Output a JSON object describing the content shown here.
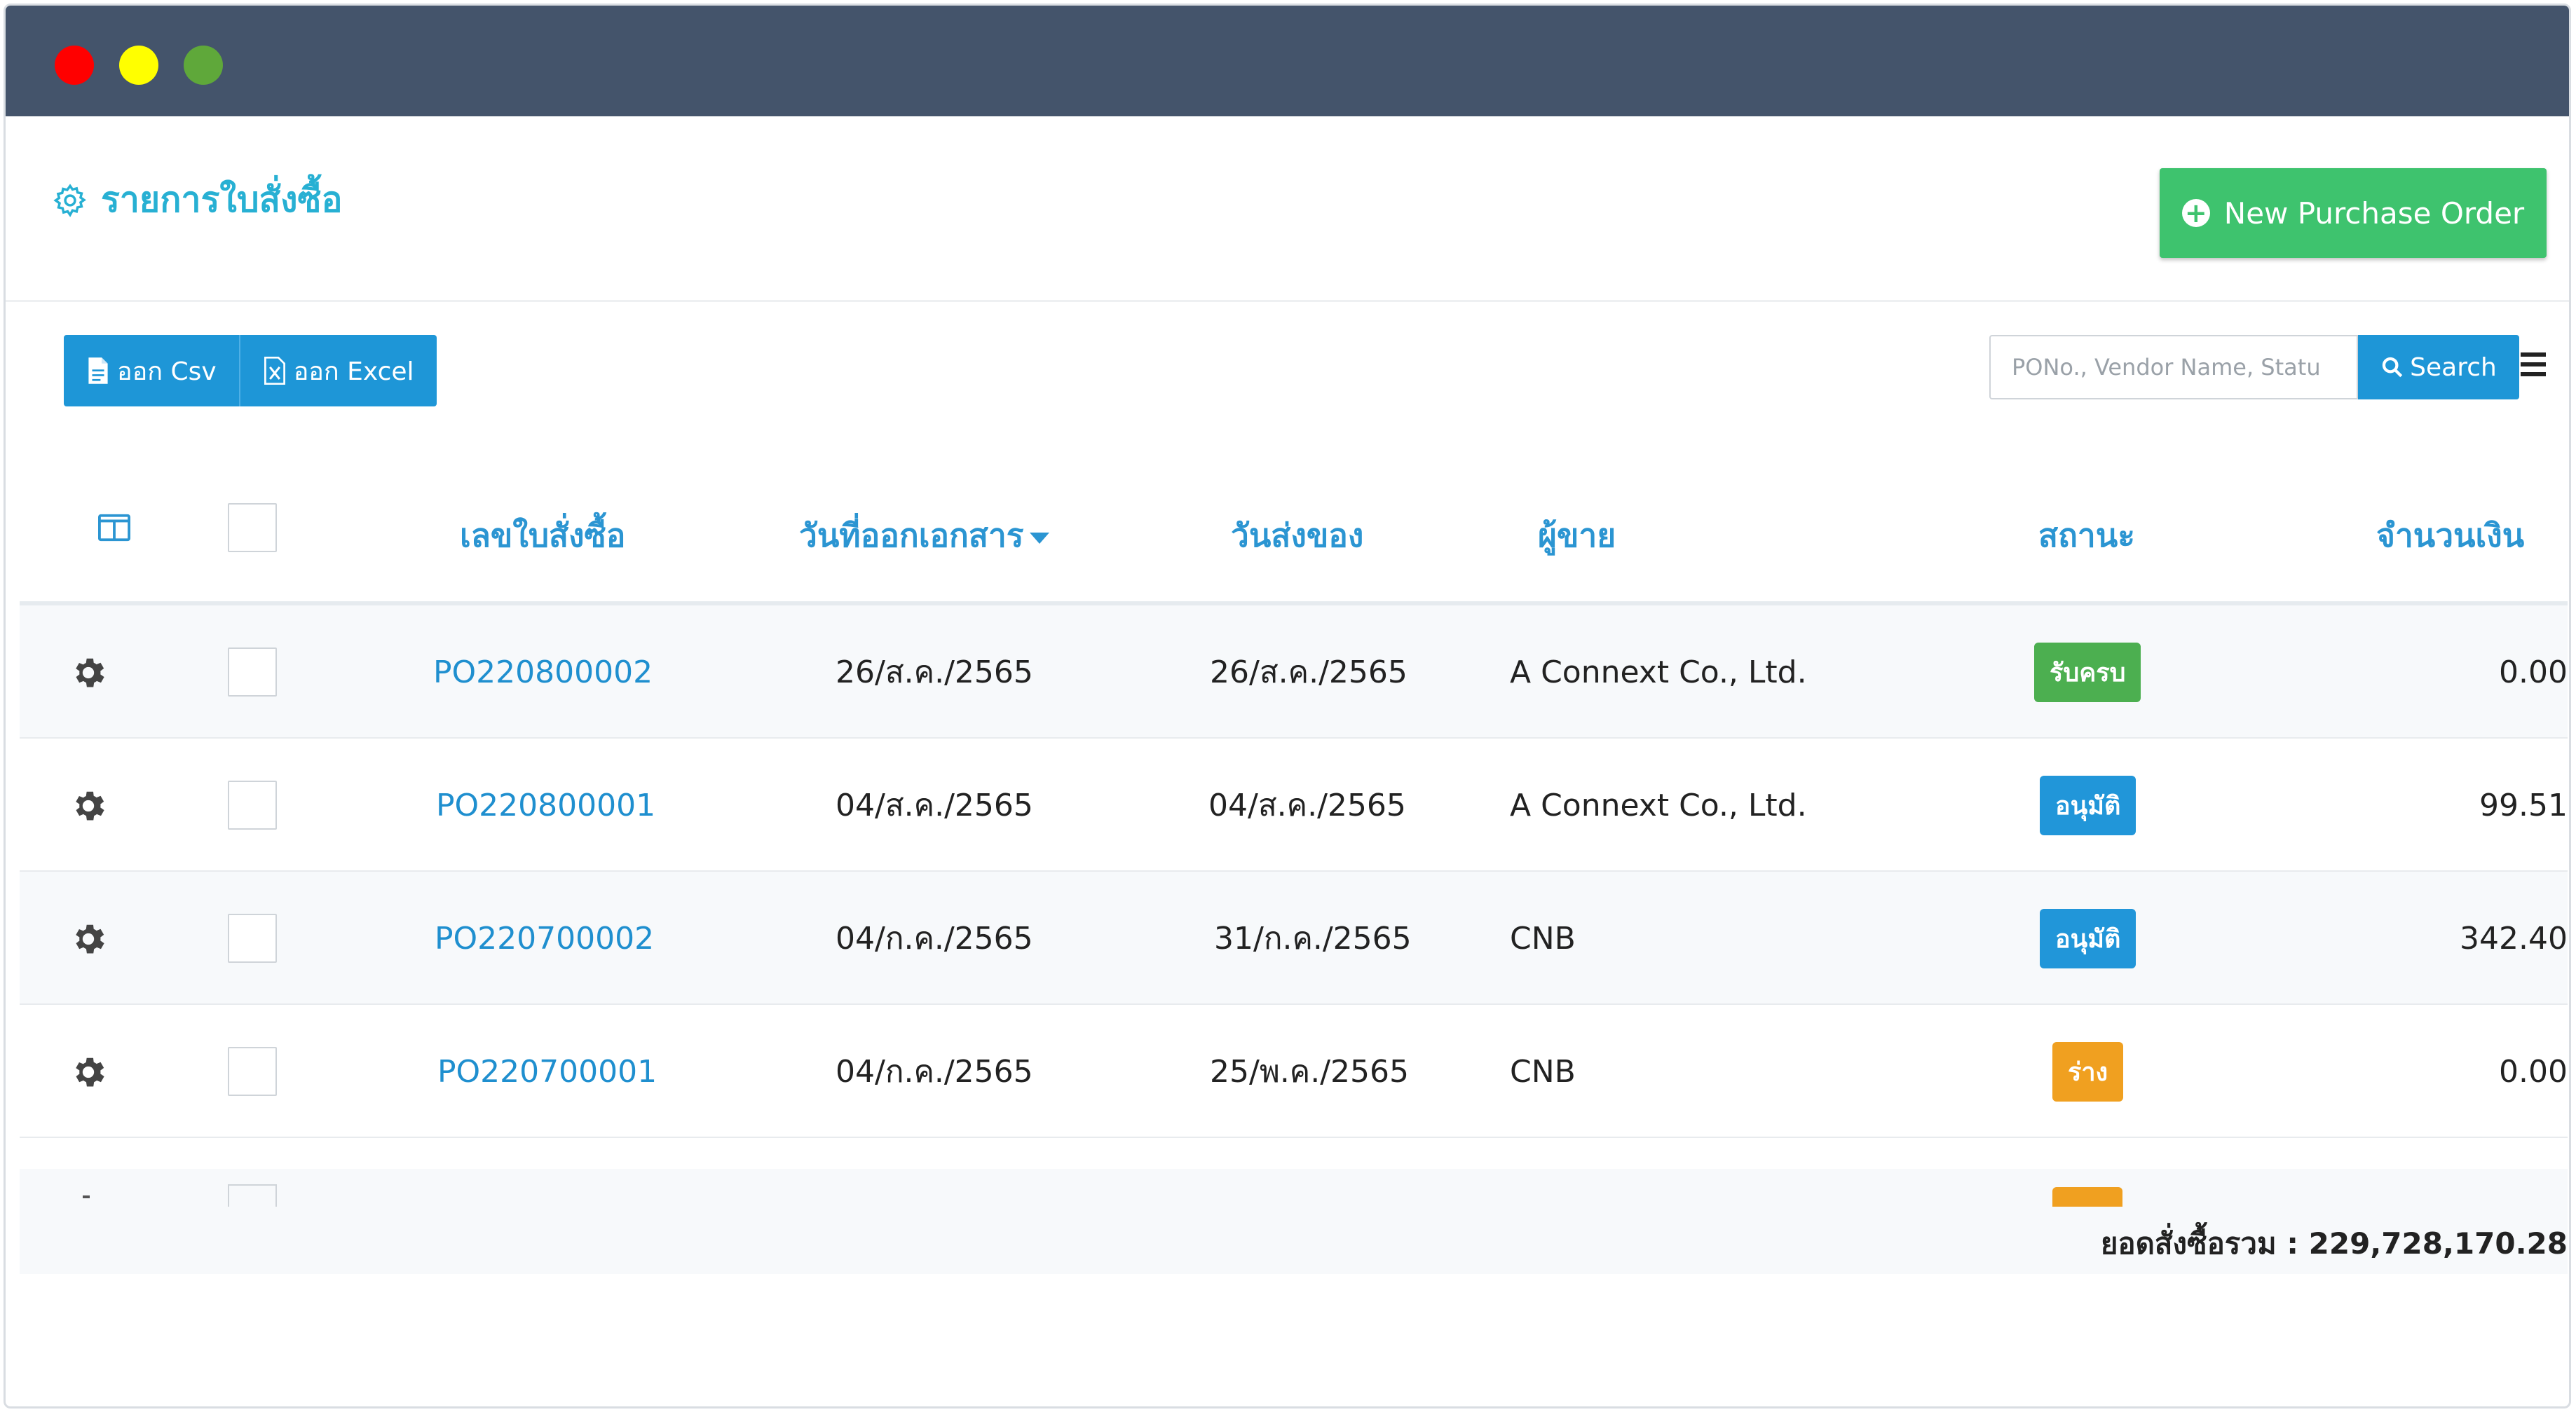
{
  "window": {
    "dots": [
      "red",
      "yellow",
      "green"
    ]
  },
  "header": {
    "title": "รายการใบสั่งซื้อ",
    "title_icon": "gear-outline-icon",
    "new_button": "New Purchase Order"
  },
  "toolbar": {
    "export_csv": "ออก Csv",
    "export_excel": "ออก Excel",
    "search_placeholder": "PONo., Vendor Name, Statu",
    "search_label": "Search"
  },
  "table": {
    "columns": [
      "เลขใบสั่งซื้อ",
      "วันที่ออกเอกสาร",
      "วันส่งของ",
      "ผู้ขาย",
      "สถานะ",
      "จำนวนเงิน"
    ],
    "sort_column": "วันที่ออกเอกสาร",
    "rows": [
      {
        "po": "PO220800002",
        "issue_date": "26/ส.ค./2565",
        "delivery_date": "26/ส.ค./2565",
        "vendor": "A Connext Co., Ltd.",
        "status": "รับครบ",
        "status_color": "#4caf50",
        "amount": "0.00"
      },
      {
        "po": "PO220800001",
        "issue_date": "04/ส.ค./2565",
        "delivery_date": "04/ส.ค./2565",
        "vendor": "A Connext Co., Ltd.",
        "status": "อนุมัติ",
        "status_color": "#2196d9",
        "amount": "99.51"
      },
      {
        "po": "PO220700002",
        "issue_date": "04/ก.ค./2565",
        "delivery_date": "31/ก.ค./2565",
        "vendor": "CNB",
        "status": "อนุมัติ",
        "status_color": "#2196d9",
        "amount": "342.40"
      },
      {
        "po": "PO220700001",
        "issue_date": "04/ก.ค./2565",
        "delivery_date": "25/พ.ค./2565",
        "vendor": "CNB",
        "status": "ร่าง",
        "status_color": "#f0a020",
        "amount": "0.00"
      }
    ],
    "total": "ยอดสั่งซื้อรวม : 229,728,170.28"
  },
  "colors": {
    "accent": "#27b0d3",
    "primary": "#1e96d7",
    "success": "#3ec36e",
    "titlebar": "#44546b"
  }
}
